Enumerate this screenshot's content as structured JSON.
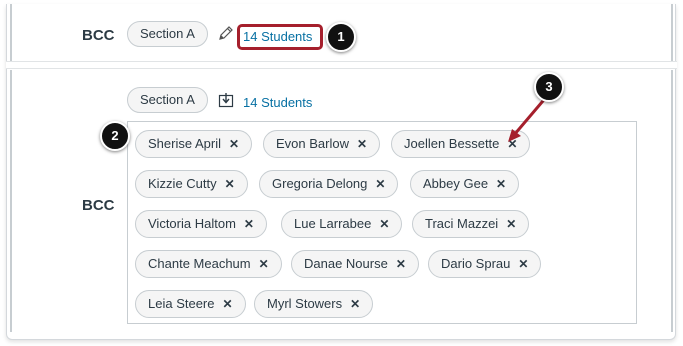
{
  "section_top": {
    "label": "BCC",
    "section_pill": "Section A",
    "students_link": "14 Students",
    "icon": "pencil-icon"
  },
  "section_bottom": {
    "label": "BCC",
    "section_pill": "Section A",
    "students_link": "14 Students",
    "icon": "import-icon"
  },
  "callouts": {
    "one": "1",
    "two": "2",
    "three": "3"
  },
  "students": [
    "Sherise April",
    "Evon Barlow",
    "Joellen Bessette",
    "Kizzie Cutty",
    "Gregoria Delong",
    "Abbey Gee",
    "Victoria Haltom",
    "Lue Larrabee",
    "Traci Mazzei",
    "Chante Meachum",
    "Danae Nourse",
    "Dario Sprau",
    "Leia Steere",
    "Myrl Stowers"
  ],
  "remove_glyph": "✕",
  "colors": {
    "link": "#0770a3",
    "highlight": "#a51f2c",
    "arrow": "#a51f2c"
  }
}
